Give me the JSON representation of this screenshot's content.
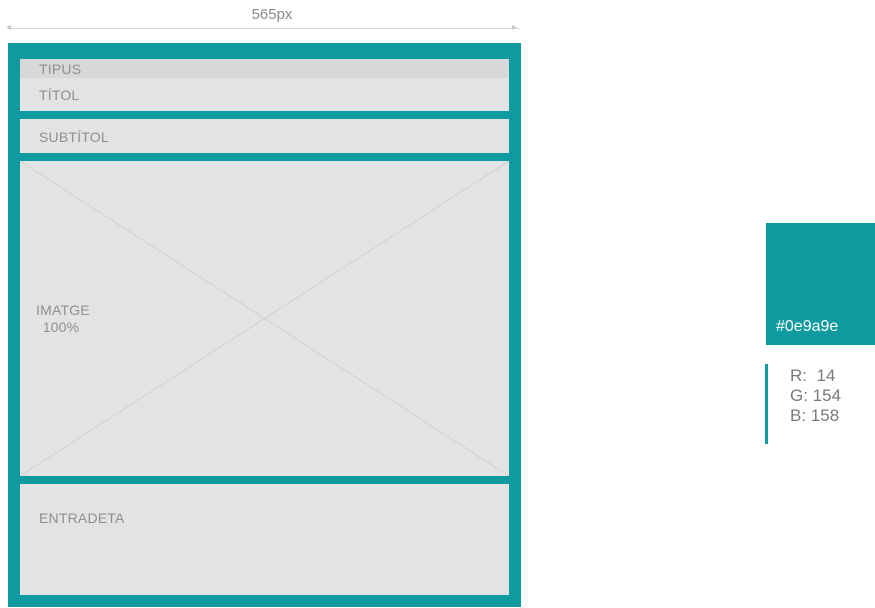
{
  "dimension_label": "565px",
  "wireframe": {
    "tipus_label": "TIPUS",
    "titol_label": "TÍTOL",
    "subtitol_label": "SUBTÍTOL",
    "imatge_label": "IMATGE",
    "imatge_size": "100%",
    "entradeta_label": "ENTRADETA"
  },
  "swatch": {
    "hex": "#0e9a9e",
    "r": "R:  14",
    "g": "G: 154",
    "b": "B: 158"
  },
  "colors": {
    "frame": "#0e9a9e",
    "block": "#e1e3e4",
    "tipus_block": "#d6d8d9",
    "label_text": "#8f8f8f"
  }
}
